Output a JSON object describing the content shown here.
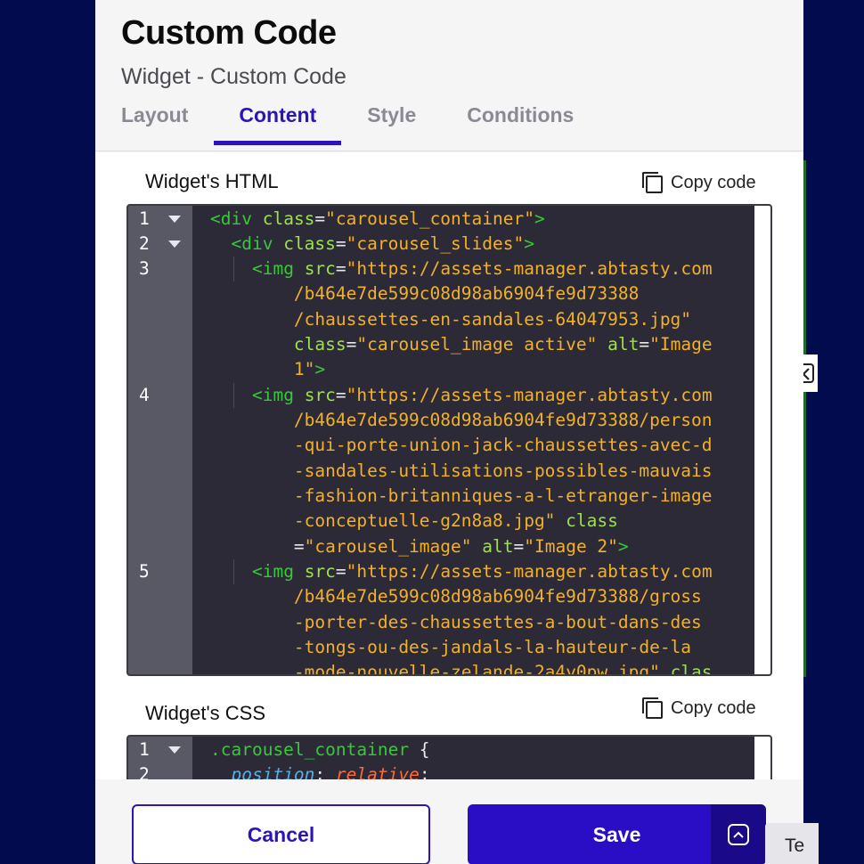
{
  "header": {
    "title": "Custom Code",
    "subtitle": "Widget - Custom Code",
    "tabs": [
      {
        "label": "Layout",
        "active": false
      },
      {
        "label": "Content",
        "active": true
      },
      {
        "label": "Style",
        "active": false
      },
      {
        "label": "Conditions",
        "active": false
      }
    ]
  },
  "html_section": {
    "label": "Widget's HTML",
    "copy_label": "Copy code",
    "line_numbers": [
      "1",
      "2",
      "3",
      "4",
      "5"
    ]
  },
  "css_section": {
    "label": "Widget's CSS",
    "copy_label": "Copy code",
    "line_numbers": [
      "1",
      "2"
    ]
  },
  "footer": {
    "cancel_label": "Cancel",
    "save_label": "Save",
    "peek_label": "Te"
  },
  "colors": {
    "accent": "#2a15b8",
    "save_bg": "#2a0ec6",
    "editor_bg": "#2b2a36",
    "page_bg": "#020b4e"
  },
  "icons": [
    "copy-icon",
    "fold-arrow-icon",
    "chevron-up-icon",
    "collapse-panel-icon"
  ]
}
